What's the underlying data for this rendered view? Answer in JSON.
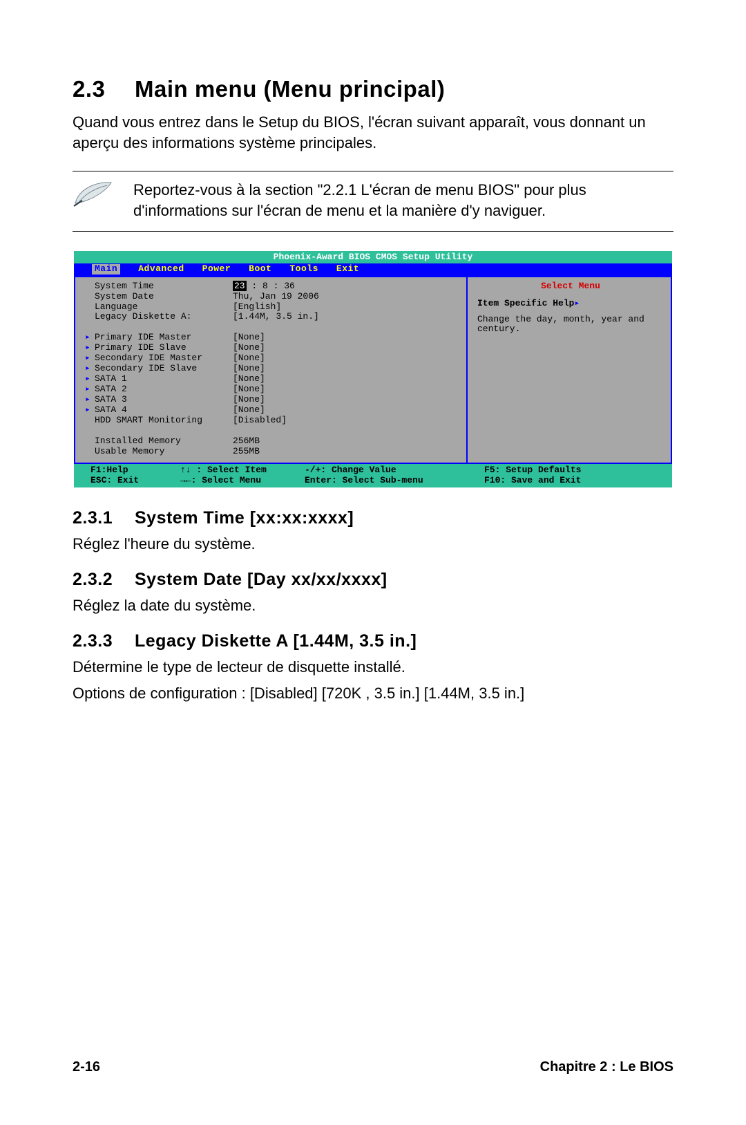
{
  "heading": {
    "number": "2.3",
    "title": "Main menu (Menu principal)"
  },
  "intro": "Quand vous entrez dans le Setup du BIOS, l'écran suivant apparaît, vous donnant un aperçu des informations système principales.",
  "note": "Reportez-vous à la section \"2.2.1 L'écran de menu BIOS\" pour plus d'informations sur l'écran de menu et la manière d'y naviguer.",
  "bios": {
    "title": "Phoenix-Award BIOS CMOS Setup Utility",
    "tabs": [
      "Main",
      "Advanced",
      "Power",
      "Boot",
      "Tools",
      "Exit"
    ],
    "active_tab": "Main",
    "rows": [
      {
        "arrow": false,
        "label": "System Time",
        "value": "23",
        "value_selected": true,
        "value_suffix": " : 8 : 36"
      },
      {
        "arrow": false,
        "label": "System Date",
        "value": "Thu, Jan 19 2006"
      },
      {
        "arrow": false,
        "label": "Language",
        "value": "[English]"
      },
      {
        "arrow": false,
        "label": "Legacy Diskette A:",
        "value": "[1.44M, 3.5 in.]"
      },
      {
        "blank": true
      },
      {
        "arrow": true,
        "label": "Primary IDE Master",
        "value": "[None]"
      },
      {
        "arrow": true,
        "label": "Primary IDE Slave",
        "value": "[None]"
      },
      {
        "arrow": true,
        "label": "Secondary IDE Master",
        "value": "[None]"
      },
      {
        "arrow": true,
        "label": "Secondary IDE Slave",
        "value": "[None]"
      },
      {
        "arrow": true,
        "label": "SATA 1",
        "value": "[None]"
      },
      {
        "arrow": true,
        "label": "SATA 2",
        "value": "[None]"
      },
      {
        "arrow": true,
        "label": "SATA 3",
        "value": "[None]"
      },
      {
        "arrow": true,
        "label": "SATA 4",
        "value": "[None]"
      },
      {
        "arrow": false,
        "label": "HDD SMART Monitoring",
        "value": "[Disabled]"
      },
      {
        "blank": true
      },
      {
        "arrow": false,
        "label": "Installed Memory",
        "value": "256MB"
      },
      {
        "arrow": false,
        "label": "Usable Memory",
        "value": "255MB"
      }
    ],
    "right": {
      "select_menu": "Select Menu",
      "item_specific_help": "Item Specific Help",
      "help_text": "Change the day, month, year and century."
    },
    "footer": {
      "c1a": "F1:Help",
      "c2a": "↑↓ : Select Item",
      "c3a": "-/+: Change Value",
      "c4a": "F5: Setup Defaults",
      "c1b": "ESC: Exit",
      "c2b": "→←: Select Menu",
      "c3b": "Enter: Select Sub-menu",
      "c4b": "F10: Save and Exit"
    }
  },
  "subsections": [
    {
      "num": "2.3.1",
      "title": "System Time [xx:xx:xxxx]",
      "body": "Réglez l'heure du système."
    },
    {
      "num": "2.3.2",
      "title": "System Date [Day xx/xx/xxxx]",
      "body": "Réglez la date du système."
    },
    {
      "num": "2.3.3",
      "title": "Legacy Diskette A [1.44M, 3.5 in.]",
      "body": "Détermine le type de lecteur de disquette installé.\nOptions de configuration : [Disabled]  [720K , 3.5 in.] [1.44M, 3.5 in.]"
    }
  ],
  "footer": {
    "left": "2-16",
    "right": "Chapitre 2 : Le BIOS"
  }
}
